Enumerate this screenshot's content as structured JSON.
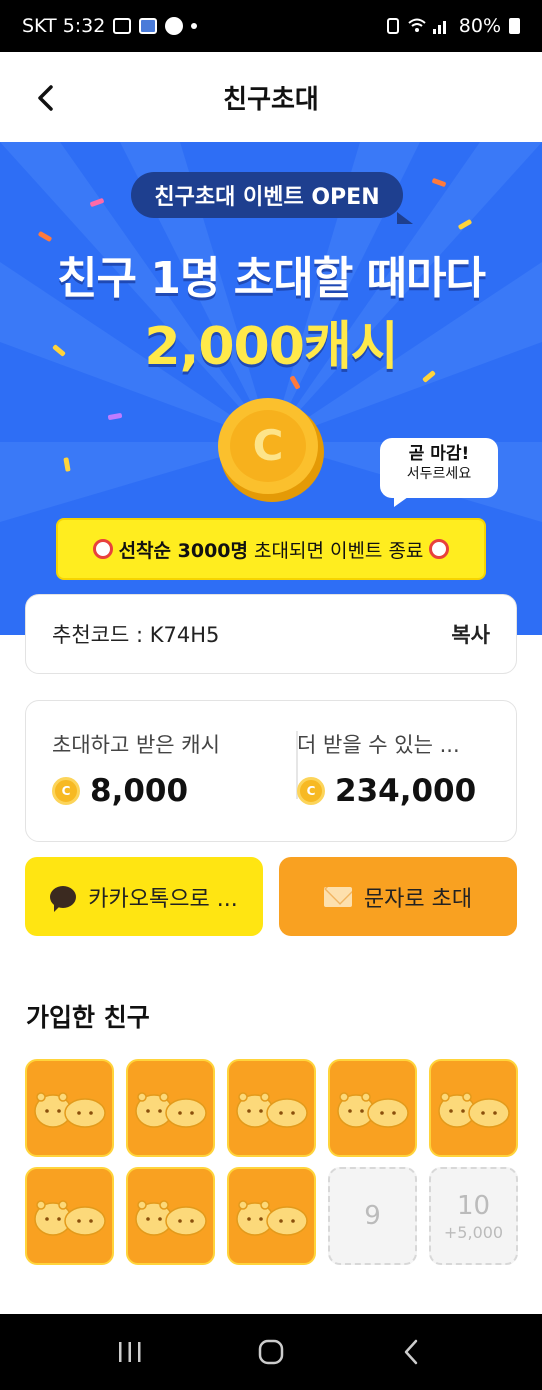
{
  "status_bar": {
    "carrier_time": "SKT 5:32",
    "battery": "80%"
  },
  "header": {
    "title": "친구초대"
  },
  "banner": {
    "pill": "친구초대 이벤트 OPEN",
    "headline": "친구 1명 초대할 때마다",
    "amount": "2,000캐시",
    "speech_title": "곧 마감!",
    "speech_sub": "서두르세요",
    "promo_strong": "선착순 3000명",
    "promo_rest": "초대되면 이벤트 종료"
  },
  "referral": {
    "code_label": "추천코드 : K74H5",
    "copy": "복사"
  },
  "stats": {
    "earned_label": "초대하고 받은 캐시",
    "earned_value": "8,000",
    "more_label": "더 받을 수 있는 ...",
    "more_value": "234,000"
  },
  "share": {
    "kakao": "카카오톡으로 ...",
    "sms": "문자로 초대"
  },
  "friends": {
    "title": "가입한 친구",
    "filled_count": 8,
    "empty_slots": [
      {
        "num": "9",
        "bonus": ""
      },
      {
        "num": "10",
        "bonus": "+5,000"
      }
    ]
  },
  "colors": {
    "banner_blue": "#2e6ef5",
    "promo_yellow": "#ffed1f",
    "kakao_yellow": "#ffe512",
    "sms_orange": "#f9a121"
  }
}
